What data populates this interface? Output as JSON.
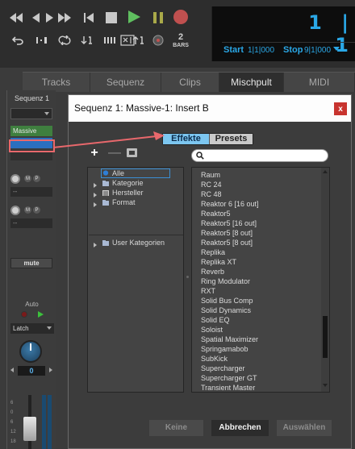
{
  "colors": {
    "accent_blue": "#2aa7e6",
    "record_red": "#c0504f",
    "play_green": "#3cc13c",
    "callout_red": "#e8686c",
    "close_red": "#c8342f",
    "tab_active_bg": "#7cc6f0"
  },
  "transport": {
    "buttons_row1": [
      {
        "icon": "rewind-icon"
      },
      {
        "icon": "step-back-icon"
      },
      {
        "icon": "step-forward-icon"
      },
      {
        "icon": "fast-forward-icon"
      },
      {
        "icon": "return-to-zero-icon"
      },
      {
        "icon": "stop-icon"
      },
      {
        "icon": "play-icon"
      },
      {
        "icon": "pause-icon"
      },
      {
        "icon": "record-icon"
      }
    ],
    "buttons_row2": [
      {
        "icon": "undo-icon"
      },
      {
        "icon": "loop-marker-icon"
      },
      {
        "icon": "cycle-icon"
      },
      {
        "icon": "sort-down-icon"
      },
      {
        "icon": "bars-icon"
      },
      {
        "icon": "punch-icon"
      },
      {
        "icon": "sort-up-icon"
      },
      {
        "icon": "metronome-icon"
      }
    ],
    "precount_number": "2",
    "precount_label": "BARS",
    "counter": "1 | 1",
    "start_label": "Start",
    "start_value": "1|1|000",
    "stop_label": "Stop",
    "stop_value": "9|1|000"
  },
  "tabs": [
    {
      "label": "Tracks",
      "active": false
    },
    {
      "label": "Sequenz",
      "active": false
    },
    {
      "label": "Clips",
      "active": false
    },
    {
      "label": "Mischpult",
      "active": true
    },
    {
      "label": "MIDI",
      "active": false
    }
  ],
  "strip": {
    "name": "Sequenz 1",
    "insert_1": "Massive",
    "send_m": "M",
    "send_p": "P",
    "send_empty": "--",
    "mute": "mute",
    "auto_label": "Auto",
    "automation_mode": "Latch",
    "pan_value": "0",
    "scale": [
      "6",
      "0",
      "6",
      "12",
      "18"
    ]
  },
  "dialog": {
    "title": "Sequenz 1: Massive-1: Insert B",
    "close": "x",
    "segment_effects": "Effekte",
    "segment_presets": "Presets",
    "add": "+",
    "remove": "—",
    "search_placeholder": "",
    "tree": [
      {
        "label": "Alle",
        "icon": "blue-dot-icon",
        "arrow": false,
        "selected": true
      },
      {
        "label": "Kategorie",
        "icon": "folder-icon",
        "arrow": true
      },
      {
        "label": "Hersteller",
        "icon": "list-icon",
        "arrow": true
      },
      {
        "label": "Format",
        "icon": "folder-icon",
        "arrow": true
      }
    ],
    "tree_user": {
      "label": "User Kategorien",
      "icon": "folder-icon",
      "arrow": true
    },
    "plugins": [
      "Raum",
      "RC 24",
      "RC 48",
      "Reaktor 6 [16 out]",
      "Reaktor5",
      "Reaktor5 [16 out]",
      "Reaktor5 [8 out]",
      "Reaktor5 [8 out]",
      "Replika",
      "Replika XT",
      "Reverb",
      "Ring Modulator",
      "RXT",
      "Solid Bus Comp",
      "Solid Dynamics",
      "Solid EQ",
      "Soloist",
      "Spatial Maximizer",
      "Springamabob",
      "SubKick",
      "Supercharger",
      "Supercharger GT",
      "Transient Master"
    ],
    "btn_none": "Keine",
    "btn_cancel": "Abbrechen",
    "btn_select": "Auswählen"
  }
}
